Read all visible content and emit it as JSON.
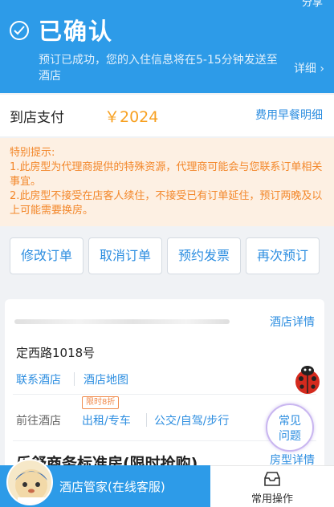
{
  "header": {
    "share_label": "分享",
    "title": "已确认",
    "subtitle": "预订已成功，您的入住信息将在5-15分钟发送至酒店",
    "detail_link": "详细 ›"
  },
  "payment": {
    "label": "到店支付",
    "amount": "￥2024",
    "breakdown_link": "费用早餐明细"
  },
  "notice": {
    "title": "特别提示:",
    "line1": "1.此房型为代理商提供的特殊资源，代理商可能会与您联系订单相关事宜。",
    "line2": "2.此房型不接受在店客人续住，不接受已有订单延住，预订两晚及以上可能需要换房。"
  },
  "actions": {
    "modify": "修改订单",
    "cancel": "取消订单",
    "invoice": "预约发票",
    "rebook": "再次预订"
  },
  "hotel": {
    "detail_link": "酒店详情",
    "address": "定西路1018号",
    "contact_link": "联系酒店",
    "map_link": "酒店地图",
    "goto_label": "前往酒店",
    "discount_badge": "限时8折",
    "taxi_link": "出租/专车",
    "self_link": "公交/自驾/步行",
    "room_name": "乐舒商务标准房(限时抢购)",
    "room_detail_link": "房型详情"
  },
  "faq": {
    "line1": "常见",
    "line2": "问题"
  },
  "bottom": {
    "chat_label": "酒店管家(在线客服)",
    "ops_label": "常用操作"
  },
  "colors": {
    "brand_blue": "#2d9be8",
    "link_blue": "#2d8ee0",
    "price_orange": "#f7a020",
    "notice_orange": "#f3872a",
    "notice_bg": "#fdf0e3"
  }
}
